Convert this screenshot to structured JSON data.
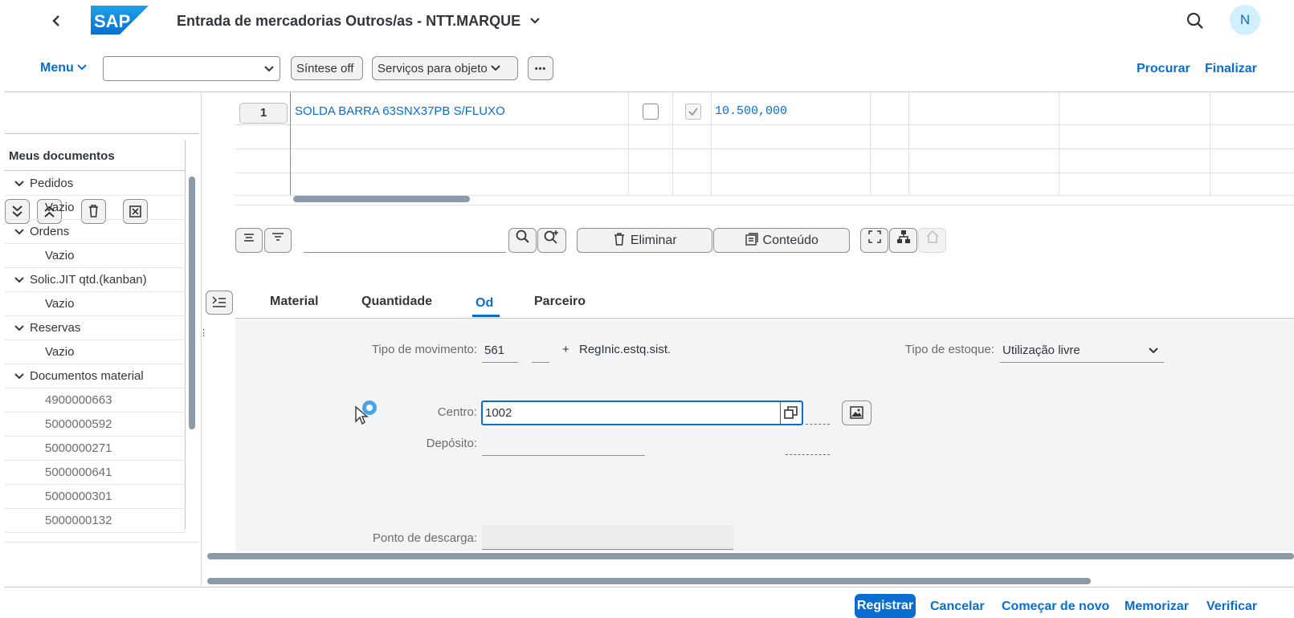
{
  "header": {
    "back_icon": "chevron-left-icon",
    "logo_text": "SAP",
    "title": "Entrada de mercadorias Outros/as - NTT.MARQUE",
    "avatar_initial": "N",
    "brand_color": "#0a6ed1"
  },
  "toolbar": {
    "menu_label": "Menu",
    "dropdown_value": "",
    "sintese_label": "Síntese off",
    "servicos_label": "Serviços para objeto",
    "more_label": "•••",
    "procurar_label": "Procurar",
    "finalizar_label": "Finalizar"
  },
  "sidebar": {
    "title": "Meus documentos",
    "items": [
      {
        "label": "Pedidos",
        "type": "group"
      },
      {
        "label": "Vazio",
        "type": "leaf"
      },
      {
        "label": "Ordens",
        "type": "group"
      },
      {
        "label": "Vazio",
        "type": "leaf"
      },
      {
        "label": "Solic.JIT qtd.(kanban)",
        "type": "group"
      },
      {
        "label": "Vazio",
        "type": "leaf"
      },
      {
        "label": "Reservas",
        "type": "group"
      },
      {
        "label": "Vazio",
        "type": "leaf"
      },
      {
        "label": "Documentos material",
        "type": "group"
      },
      {
        "label": "4900000663",
        "type": "doc"
      },
      {
        "label": "5000000592",
        "type": "doc"
      },
      {
        "label": "5000000271",
        "type": "doc"
      },
      {
        "label": "5000000641",
        "type": "doc"
      },
      {
        "label": "5000000301",
        "type": "doc"
      },
      {
        "label": "5000000132",
        "type": "doc"
      }
    ]
  },
  "grid": {
    "row_number": "1",
    "material_text": "SOLDA BARRA 63SNX37PB S/FLUXO",
    "checkbox1_checked": false,
    "checkbox2_checked": true,
    "quantity": "10.500,000"
  },
  "item_toolbar": {
    "search_value": "",
    "eliminar_label": "Eliminar",
    "conteudo_label": "Conteúdo"
  },
  "tabs": [
    {
      "label": "Material",
      "active": false
    },
    {
      "label": "Quantidade",
      "active": false
    },
    {
      "label": "Od",
      "active": true
    },
    {
      "label": "Parceiro",
      "active": false
    }
  ],
  "form": {
    "tipo_movimento_label": "Tipo de movimento:",
    "tipo_movimento_value": "561",
    "tipo_movimento_extra": "",
    "plus_sign": "+",
    "tipo_movimento_desc": "RegInic.estq.sist.",
    "tipo_estoque_label": "Tipo de estoque:",
    "tipo_estoque_value": "Utilização livre",
    "centro_label": "Centro:",
    "centro_value": "1002",
    "deposito_label": "Depósito:",
    "deposito_value": "",
    "ponto_descarga_label": "Ponto de descarga:",
    "ponto_descarga_value": ""
  },
  "footer": {
    "registrar": "Registrar",
    "cancelar": "Cancelar",
    "comecar": "Começar de novo",
    "memorizar": "Memorizar",
    "verificar": "Verificar"
  }
}
